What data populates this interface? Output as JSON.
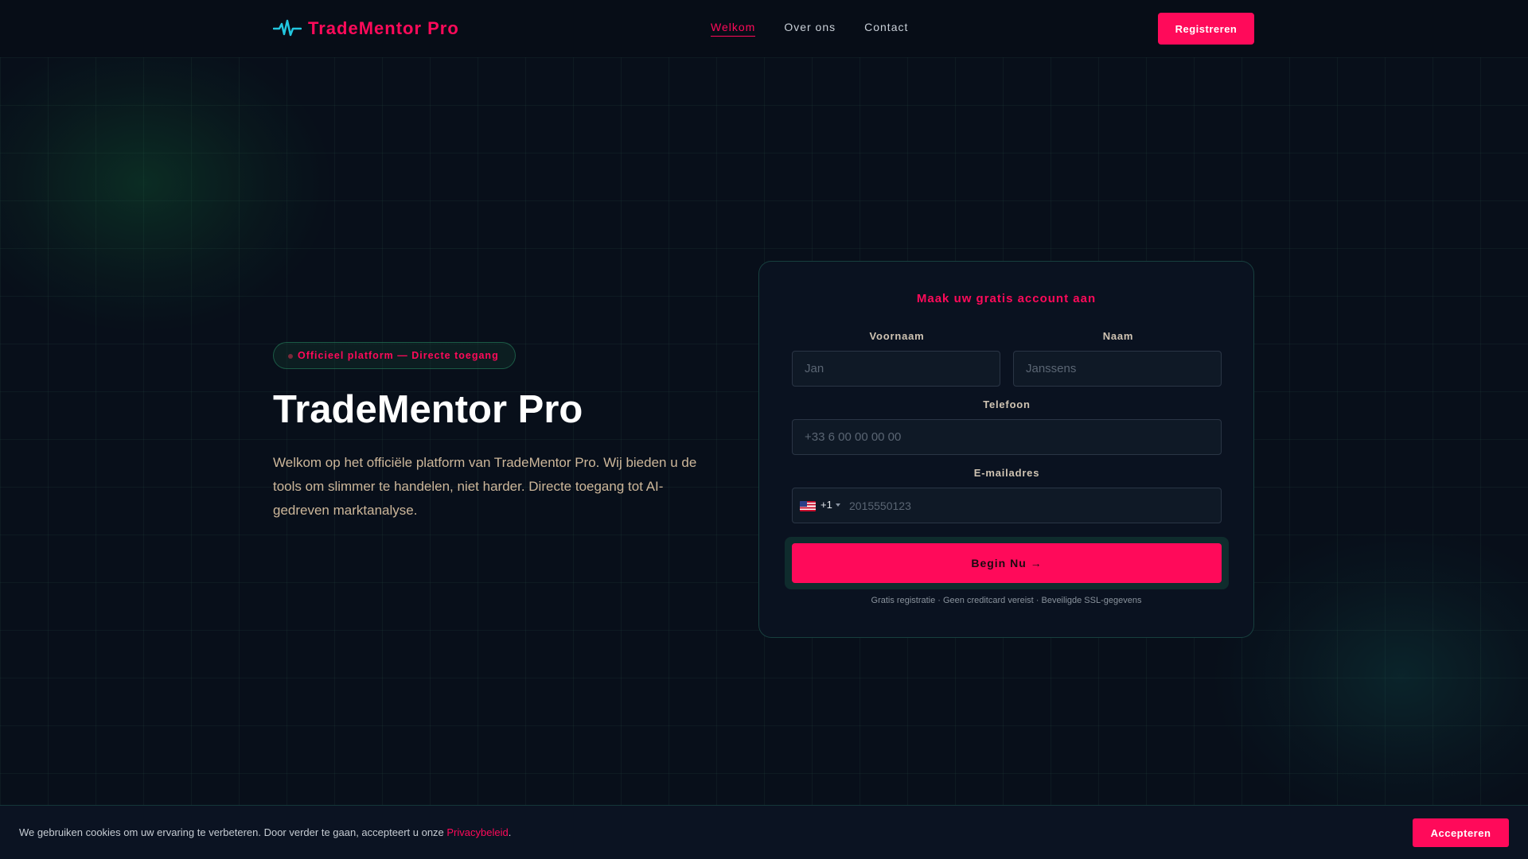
{
  "brand": {
    "name": "TradeMentor Pro",
    "icon": "pulse-heartbeat-icon"
  },
  "nav": {
    "items": [
      "Welkom",
      "Over ons",
      "Contact"
    ],
    "active": "Welkom"
  },
  "header": {
    "register_label": "Registreren"
  },
  "hero": {
    "badge": "Officieel platform — Directe toegang",
    "title": "TradeMentor Pro",
    "description": "Welkom op het officiële platform van TradeMentor Pro. Wij bieden u de tools om slimmer te handelen, niet harder. Directe toegang tot AI-gedreven marktanalyse."
  },
  "form": {
    "title": "Maak uw gratis account aan",
    "first_name": {
      "label": "Voornaam",
      "placeholder": "Jan"
    },
    "last_name": {
      "label": "Naam",
      "placeholder": "Janssens"
    },
    "telefoon": {
      "label": "Telefoon",
      "placeholder": "+33 6 00 00 00 00"
    },
    "email": {
      "label": "E-mailadres",
      "country_code": "+1",
      "country_flag": "us-flag-icon",
      "placeholder": "2015550123"
    },
    "submit_label": "Begin Nu →",
    "footnote": "Gratis registratie · Geen creditcard vereist · Beveiligde SSL-gegevens"
  },
  "cookie": {
    "text": "We gebruiken cookies om uw ervaring te verbeteren. Door verder te gaan, accepteert u onze ",
    "link": "Privacybeleid",
    "suffix": ".",
    "accept_label": "Accepteren"
  },
  "colors": {
    "accent": "#ff0a5a",
    "background": "#080f1a",
    "teal_border": "#1e6e5a",
    "logo_icon": "#22c7e0"
  }
}
